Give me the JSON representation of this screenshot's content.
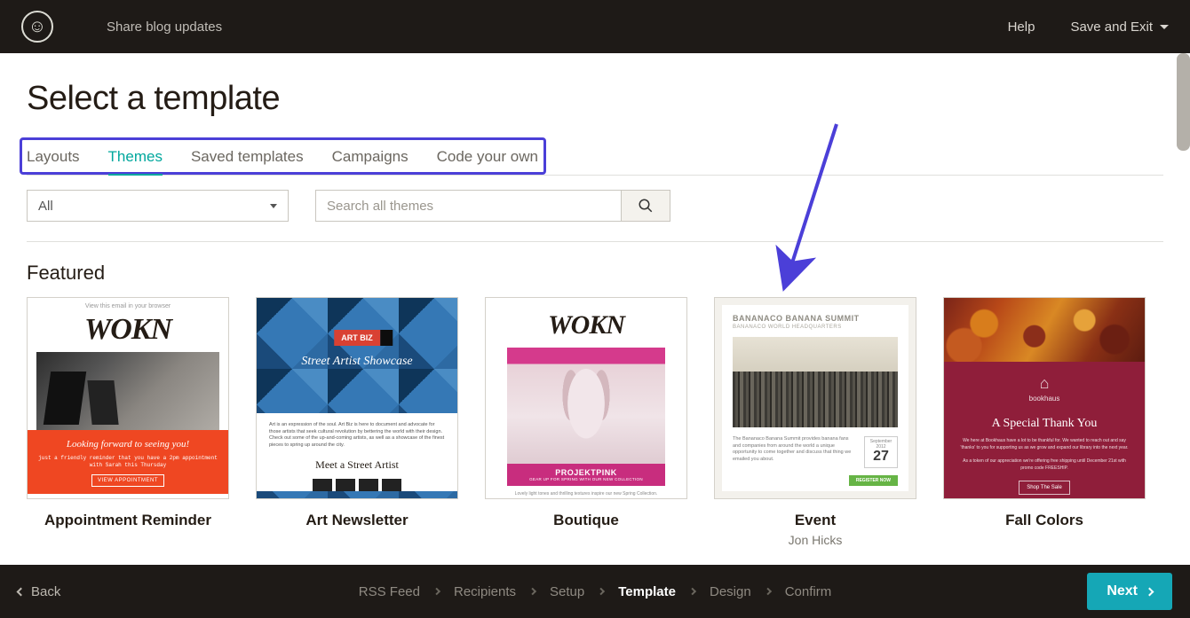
{
  "header": {
    "campaign_name": "Share blog updates",
    "help_label": "Help",
    "save_exit_label": "Save and Exit"
  },
  "main": {
    "page_title": "Select a template",
    "tabs": [
      {
        "label": "Layouts",
        "active": false
      },
      {
        "label": "Themes",
        "active": true
      },
      {
        "label": "Saved templates",
        "active": false
      },
      {
        "label": "Campaigns",
        "active": false
      },
      {
        "label": "Code your own",
        "active": false
      }
    ],
    "filter": {
      "selected": "All",
      "search_placeholder": "Search all themes"
    },
    "featured_title": "Featured",
    "templates": [
      {
        "title": "Appointment Reminder",
        "subtitle": "",
        "thumb": {
          "view_link": "View this email in your browser",
          "logo": "WOKN",
          "headline": "Looking forward to seeing you!",
          "body": "just a friendly reminder that you have a 2pm appointment with Sarah this Thursday",
          "button": "VIEW APPOINTMENT"
        }
      },
      {
        "title": "Art Newsletter",
        "subtitle": "",
        "thumb": {
          "badge": "ART BIZ",
          "hero_title": "Street Artist Showcase",
          "para": "Art is an expression of the soul. Art Biz is here to document and advocate for those artists that seek cultural revolution by bettering the world with their design. Check out some of the up-and-coming artists, as well as a showcase of the finest pieces to spring up around the city.",
          "meet": "Meet a Street Artist"
        }
      },
      {
        "title": "Boutique",
        "subtitle": "",
        "thumb": {
          "logo": "WOKN",
          "band_title": "PROJEKTPINK",
          "band_sub": "GEAR UP FOR SPRING WITH OUR NEW COLLECTION",
          "foot": "Lovely light tones and thrilling textures inspire our new Spring Collection."
        }
      },
      {
        "title": "Event",
        "subtitle": "Jon Hicks",
        "thumb": {
          "h1": "BANANACO BANANA SUMMIT",
          "h2": "BANANACO WORLD HEADQUARTERS",
          "body": "The Bananaco Banana Summit provides banana fans and companies from around the world a unique opportunity to come together and discuss that thing we emailed you about.",
          "month": "September 2012",
          "day": "27",
          "register": "REGISTER NOW"
        }
      },
      {
        "title": "Fall Colors",
        "subtitle": "",
        "thumb": {
          "brand": "bookhaus",
          "title": "A Special Thank You",
          "para": "We here at Bookhaus have a lot to be thankful for. We wanted to reach out and say 'thanks' to you for supporting us as we grow and expand our library into the next year.",
          "para2": "As a token of our appreciation we're offering free shipping until December 21st with promo code FREESHIP.",
          "button": "Shop The Sale"
        }
      }
    ]
  },
  "footer": {
    "back_label": "Back",
    "next_label": "Next",
    "steps": [
      {
        "label": "RSS Feed",
        "active": false
      },
      {
        "label": "Recipients",
        "active": false
      },
      {
        "label": "Setup",
        "active": false
      },
      {
        "label": "Template",
        "active": true
      },
      {
        "label": "Design",
        "active": false
      },
      {
        "label": "Confirm",
        "active": false
      }
    ]
  }
}
